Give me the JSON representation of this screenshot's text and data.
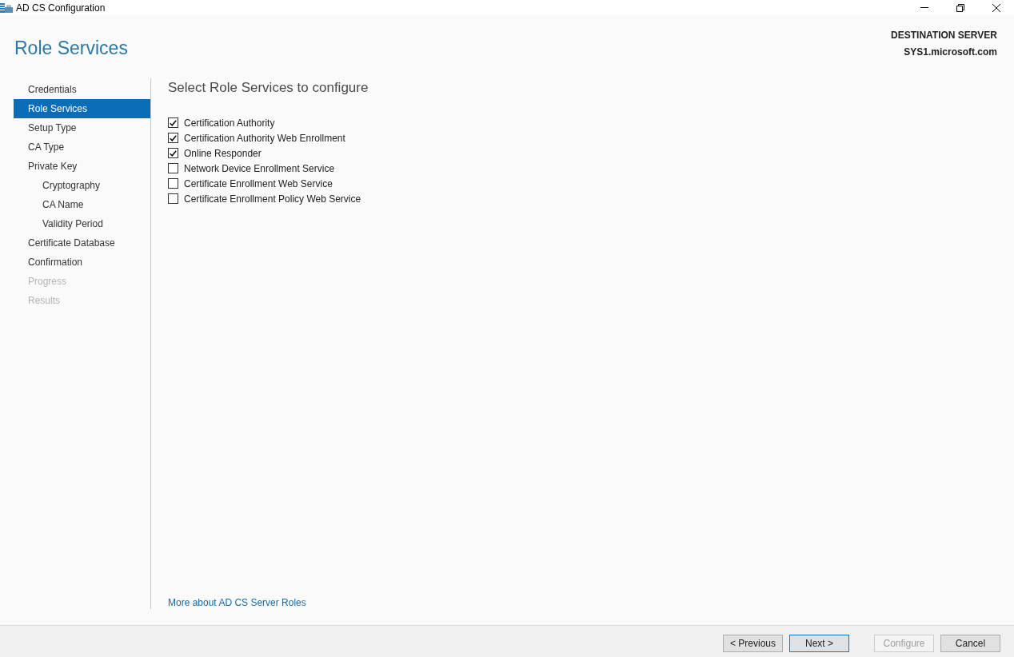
{
  "window": {
    "title": "AD CS Configuration"
  },
  "page_title": "Role Services",
  "destination_server": {
    "label": "DESTINATION SERVER",
    "name": "SYS1.microsoft.com"
  },
  "steps": [
    {
      "label": "Credentials",
      "selected": false,
      "disabled": false
    },
    {
      "label": "Role Services",
      "selected": true,
      "disabled": false
    },
    {
      "label": "Setup Type",
      "selected": false,
      "disabled": false
    },
    {
      "label": "CA Type",
      "selected": false,
      "disabled": false
    },
    {
      "label": "Private Key",
      "selected": false,
      "disabled": false,
      "children": [
        {
          "label": "Cryptography",
          "selected": false,
          "disabled": false
        },
        {
          "label": "CA Name",
          "selected": false,
          "disabled": false
        },
        {
          "label": "Validity Period",
          "selected": false,
          "disabled": false
        }
      ]
    },
    {
      "label": "Certificate Database",
      "selected": false,
      "disabled": false
    },
    {
      "label": "Confirmation",
      "selected": false,
      "disabled": false
    },
    {
      "label": "Progress",
      "selected": false,
      "disabled": true
    },
    {
      "label": "Results",
      "selected": false,
      "disabled": true
    }
  ],
  "content": {
    "heading": "Select Role Services to configure",
    "role_services": [
      {
        "label": "Certification Authority",
        "checked": true
      },
      {
        "label": "Certification Authority Web Enrollment",
        "checked": true
      },
      {
        "label": "Online Responder",
        "checked": true
      },
      {
        "label": "Network Device Enrollment Service",
        "checked": false
      },
      {
        "label": "Certificate Enrollment Web Service",
        "checked": false
      },
      {
        "label": "Certificate Enrollment Policy Web Service",
        "checked": false
      }
    ],
    "link": "More about AD CS Server Roles"
  },
  "nav_buttons": [
    {
      "label": "< Previous",
      "default": false,
      "disabled": false
    },
    {
      "label": "Next >",
      "default": true,
      "disabled": false
    }
  ],
  "action_buttons": [
    {
      "label": "Configure",
      "default": false,
      "disabled": true
    },
    {
      "label": "Cancel",
      "default": false,
      "disabled": false
    }
  ]
}
